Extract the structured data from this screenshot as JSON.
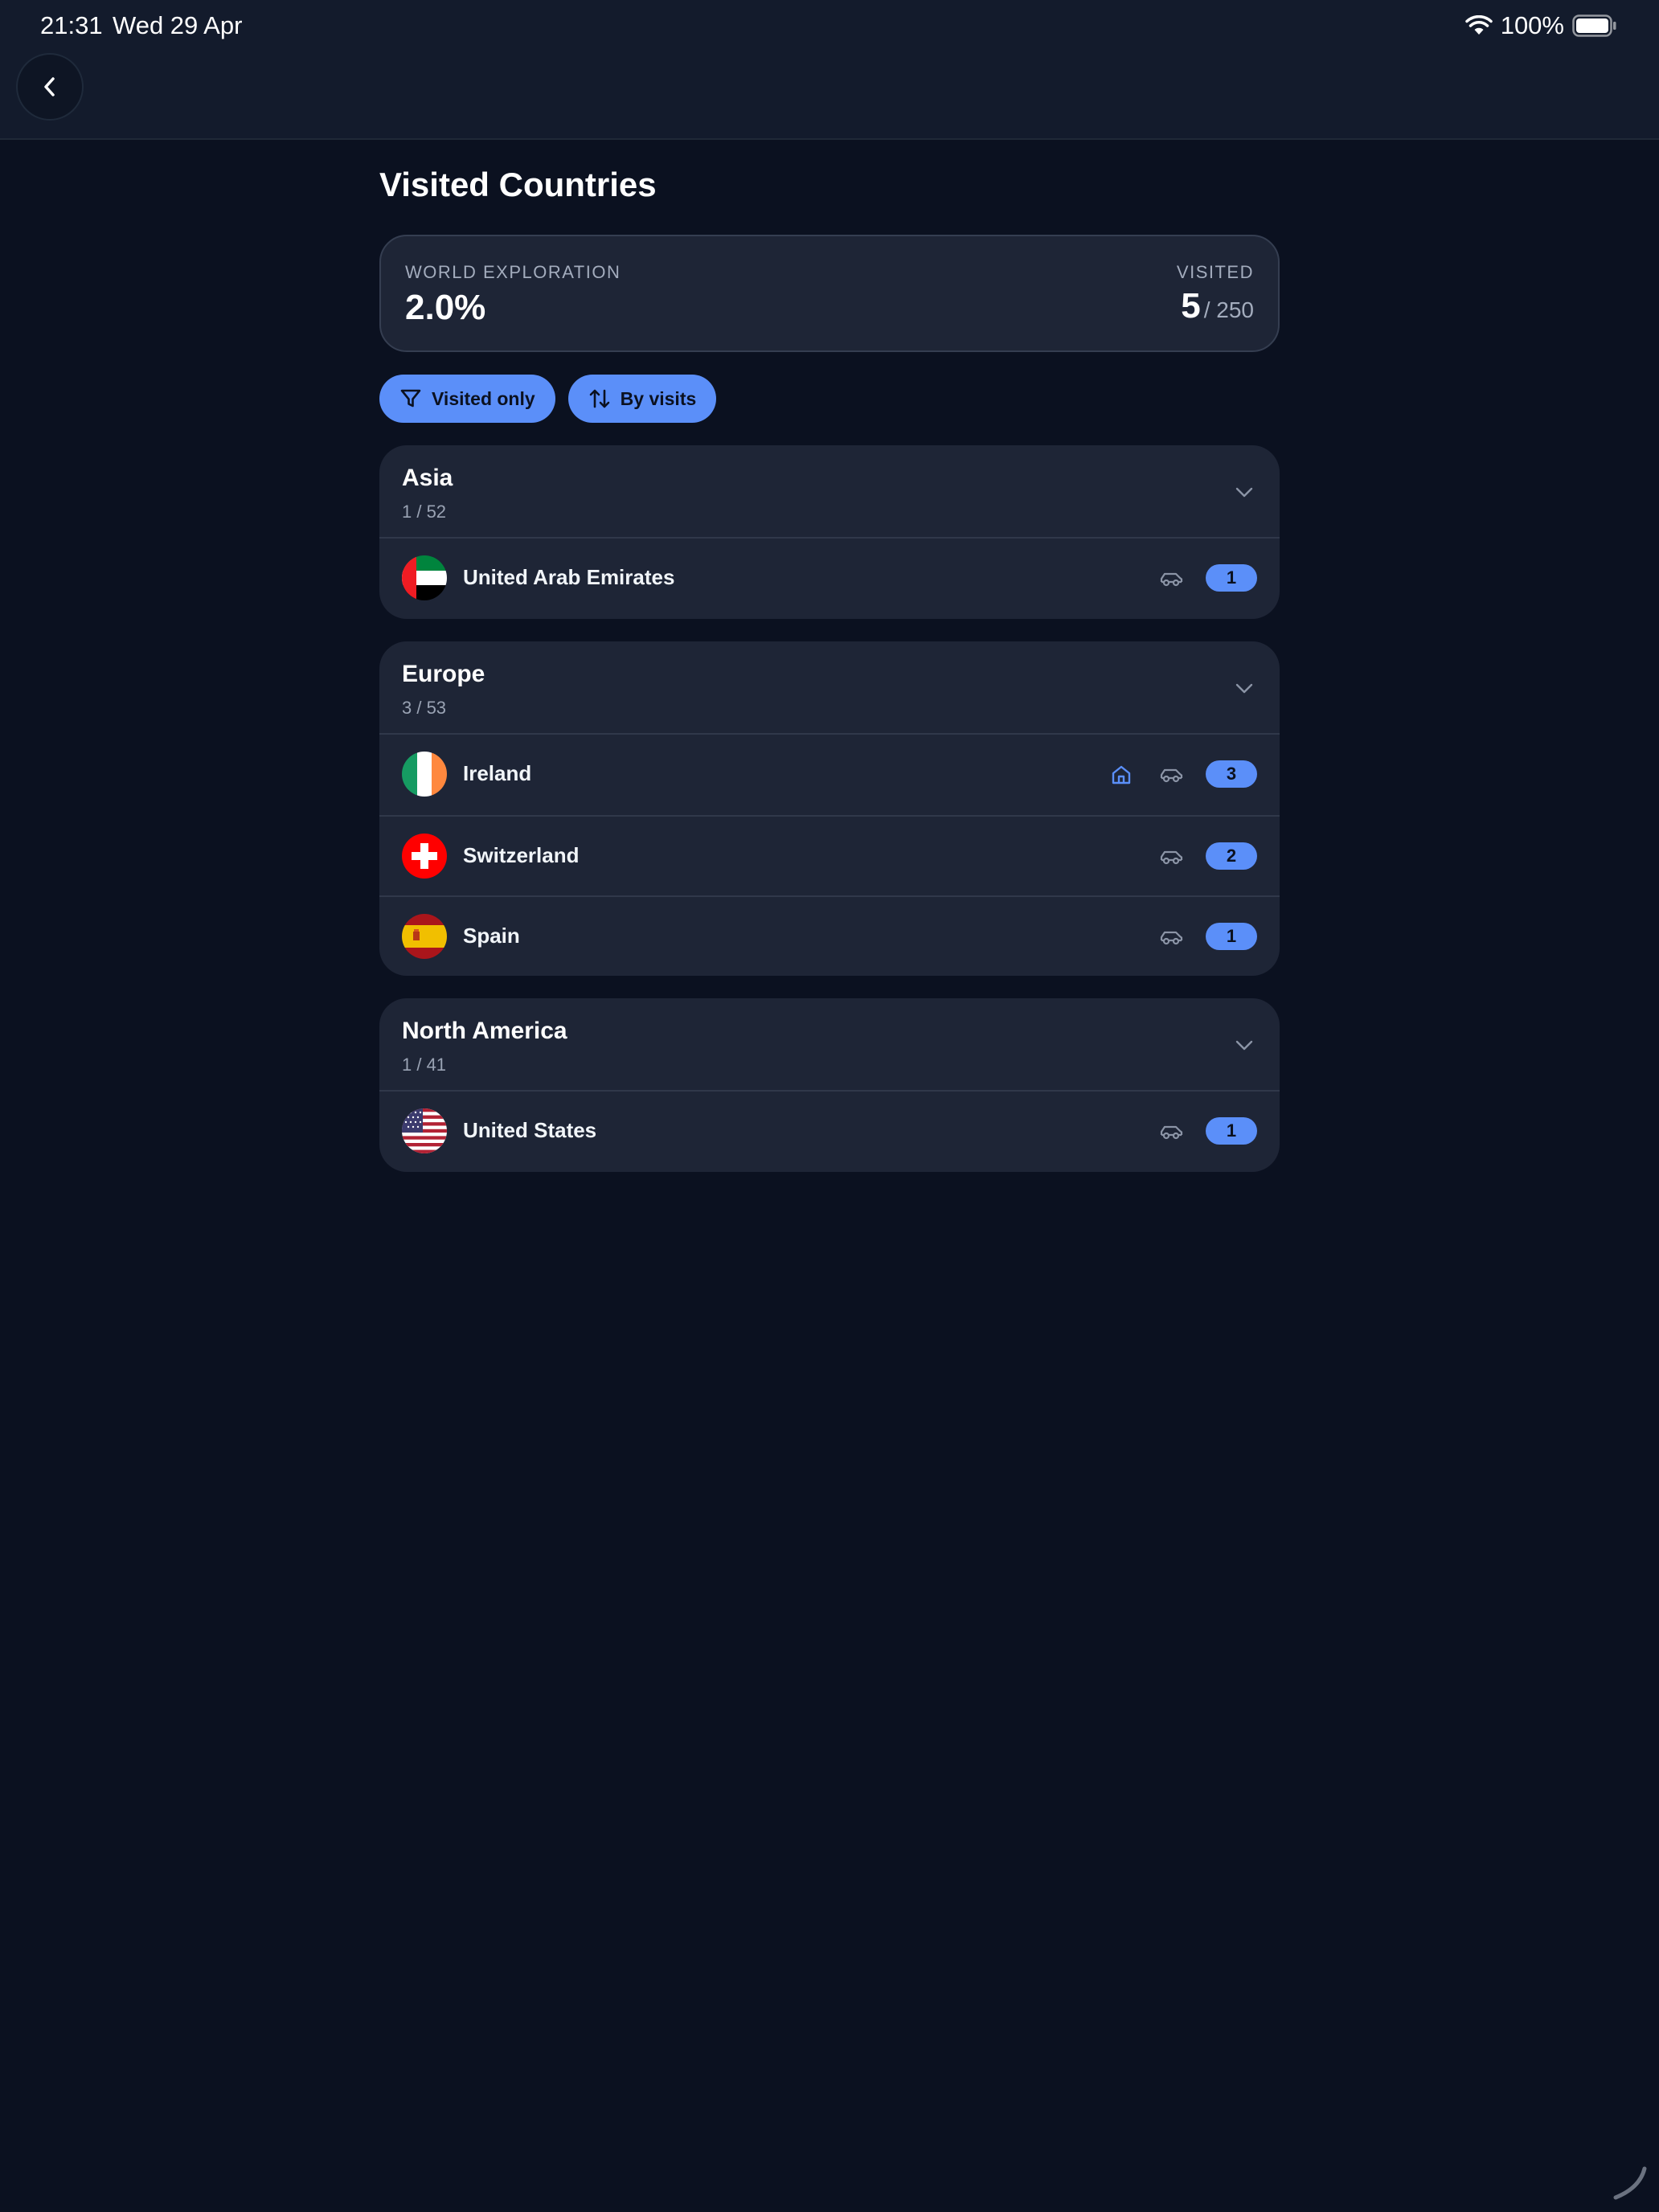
{
  "status_bar": {
    "time": "21:31",
    "date": "Wed 29 Apr",
    "battery": "100%"
  },
  "page": {
    "title": "Visited Countries"
  },
  "summary": {
    "exploration_label": "WORLD EXPLORATION",
    "exploration_value": "2.0%",
    "visited_label": "VISITED",
    "visited_count": "5",
    "visited_total": "/ 250"
  },
  "filters": {
    "visited_only": "Visited only",
    "sort": "By visits"
  },
  "regions": [
    {
      "name": "Asia",
      "count": "1 / 52",
      "countries": [
        {
          "name": "United Arab Emirates",
          "visits": "1",
          "home": false
        }
      ]
    },
    {
      "name": "Europe",
      "count": "3 / 53",
      "countries": [
        {
          "name": "Ireland",
          "visits": "3",
          "home": true
        },
        {
          "name": "Switzerland",
          "visits": "2",
          "home": false
        },
        {
          "name": "Spain",
          "visits": "1",
          "home": false
        }
      ]
    },
    {
      "name": "North America",
      "count": "1 / 41",
      "countries": [
        {
          "name": "United States",
          "visits": "1",
          "home": false
        }
      ]
    }
  ],
  "colors": {
    "background": "#0b1120",
    "card": "#1e2536",
    "accent": "#5b8ff9"
  }
}
